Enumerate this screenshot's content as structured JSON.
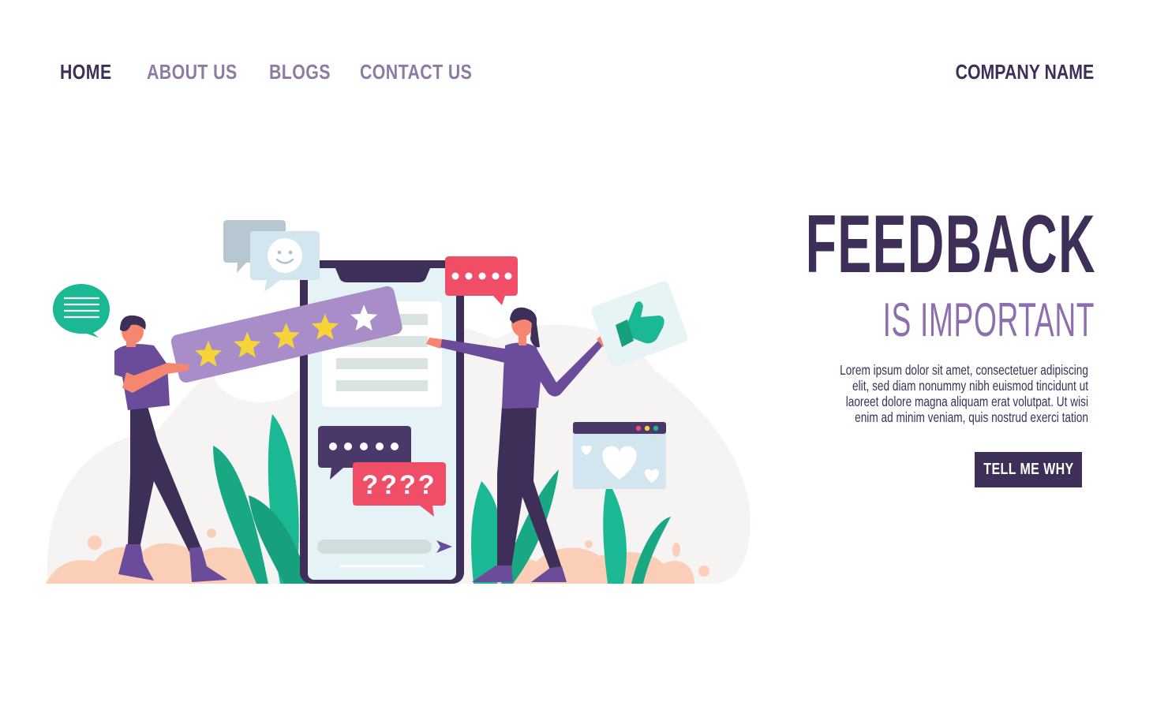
{
  "nav": {
    "items": [
      {
        "label": "HOME",
        "active": true
      },
      {
        "label": "ABOUT US",
        "active": false
      },
      {
        "label": "BLOGS",
        "active": false
      },
      {
        "label": "CONTACT US",
        "active": false
      }
    ]
  },
  "brand": {
    "company_name": "COMPANY NAME"
  },
  "hero": {
    "title": "FEEDBACK",
    "subtitle": "IS IMPORTANT",
    "body_lines": [
      "Lorem ipsum dolor sit amet, consectetuer adipiscing",
      "elit, sed diam nonummy nibh euismod tincidunt ut",
      "laoreet dolore magna aliquam erat volutpat. Ut wisi",
      "enim ad minim veniam, quis nostrud exerci tation"
    ],
    "cta_label": "TELL ME WHY"
  },
  "illustration": {
    "question_bubble_text": "????",
    "rating": {
      "filled_stars": 4,
      "total_stars": 5
    }
  },
  "colors": {
    "primary": "#3e2f58",
    "accent_purple": "#8d6fae",
    "nav_inactive": "#8d7ba6",
    "coral": "#f04e66",
    "teal": "#1bb894",
    "star_yellow": "#f7d33a"
  }
}
